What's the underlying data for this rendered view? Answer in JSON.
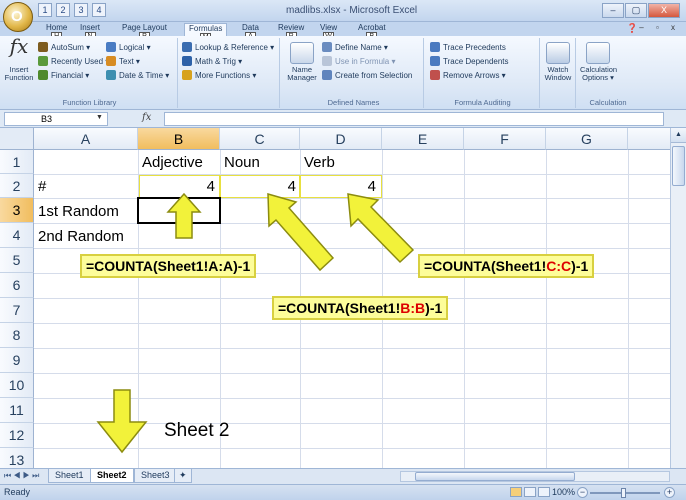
{
  "window": {
    "title": "madlibs.xlsx - Microsoft Excel",
    "min": "–",
    "max": "▢",
    "close": "X"
  },
  "qat": [
    "1",
    "2",
    "3",
    "4"
  ],
  "office_button": {
    "glyph": "O"
  },
  "tabs": [
    {
      "label": "Home",
      "key": "H"
    },
    {
      "label": "Insert",
      "key": "N"
    },
    {
      "label": "Page Layout",
      "key": "P"
    },
    {
      "label": "Formulas",
      "key": "M"
    },
    {
      "label": "Data",
      "key": "A"
    },
    {
      "label": "Review",
      "key": "R"
    },
    {
      "label": "View",
      "key": "W"
    },
    {
      "label": "Acrobat",
      "key": "B"
    }
  ],
  "ribbon": {
    "insert_function": {
      "glyph": "fx",
      "label": "Insert Function"
    },
    "autosum": "AutoSum ▾",
    "recently_used": "Recently Used ▾",
    "financial": "Financial ▾",
    "logical": "Logical ▾",
    "text": "Text ▾",
    "date_time": "Date & Time ▾",
    "lookup": "Lookup & Reference ▾",
    "math_trig": "Math & Trig ▾",
    "more_functions": "More Functions ▾",
    "function_library_label": "Function Library",
    "name_manager": "Name Manager",
    "define_name": "Define Name ▾",
    "use_in_formula": "Use in Formula ▾",
    "create_from_selection": "Create from Selection",
    "defined_names_label": "Defined Names",
    "trace_precedents": "Trace Precedents",
    "trace_dependents": "Trace Dependents",
    "remove_arrows": "Remove Arrows ▾",
    "formula_auditing_label": "Formula Auditing",
    "watch_window": "Watch Window",
    "calculation_options": "Calculation Options ▾",
    "calculation_label": "Calculation"
  },
  "formula_bar": {
    "name_box": "B3",
    "fx": "fx",
    "value": ""
  },
  "columns": [
    "A",
    "B",
    "C",
    "D",
    "E",
    "F",
    "G",
    "H"
  ],
  "rows": [
    "1",
    "2",
    "3",
    "4",
    "5",
    "6",
    "7",
    "8",
    "9",
    "10",
    "11",
    "12",
    "13"
  ],
  "cells": {
    "B1": "Adjective",
    "C1": "Noun",
    "D1": "Verb",
    "A2": "#",
    "B2": "4",
    "C2": "4",
    "D2": "4",
    "A3": "1st Random",
    "A4": "2nd Random"
  },
  "callouts": {
    "a": {
      "prefix": "=COUNTA(Sheet1!A:A)-1"
    },
    "b": {
      "prefix": "=COUNTA(Sheet1!",
      "ref": "B:B",
      "suffix": ")-1"
    },
    "c": {
      "prefix": "=COUNTA(Sheet1!",
      "ref": "C:C",
      "suffix": ")-1"
    }
  },
  "annotation": "Sheet 2",
  "sheet_tabs": [
    "Sheet1",
    "Sheet2",
    "Sheet3"
  ],
  "sheet_nav": "⏮ ◀ ▶ ⏭",
  "status": {
    "text": "Ready",
    "zoom": "100%"
  },
  "colors": {
    "arrow_fill": "#f2f23a",
    "arrow_stroke": "#8c8c10",
    "callout_bg": "#fdfd9a",
    "selected_header": "#f1bd5e"
  }
}
